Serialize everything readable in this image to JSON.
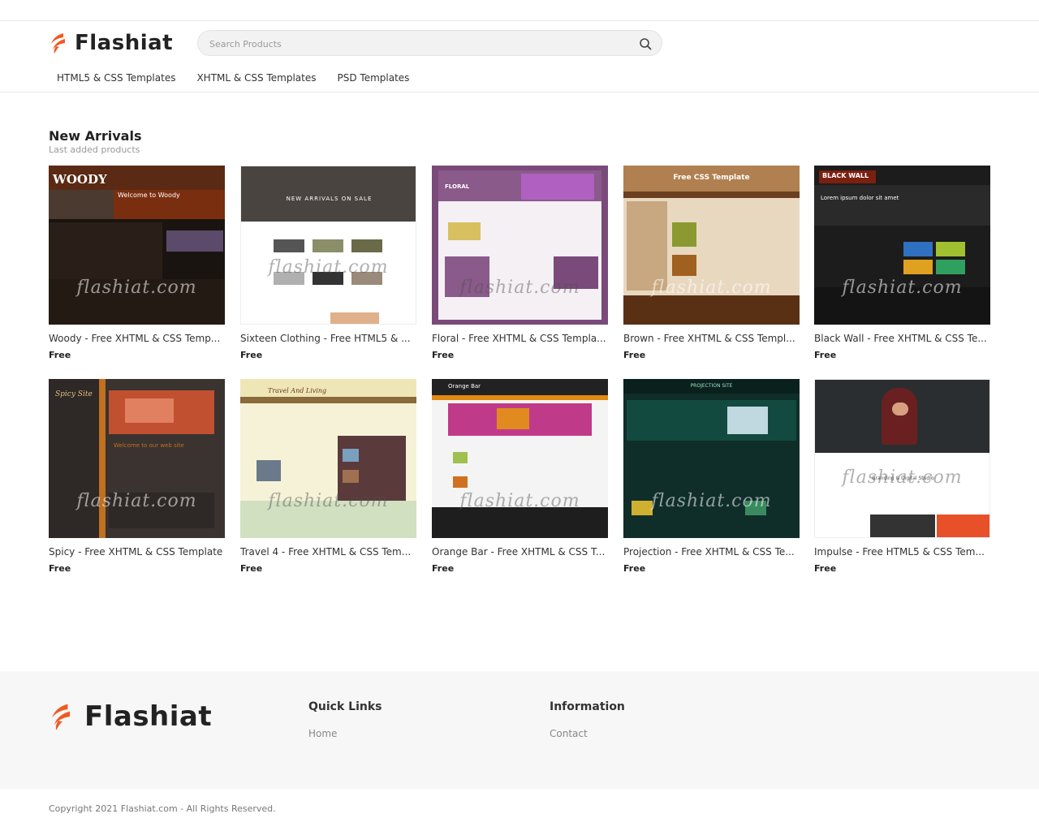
{
  "brand": {
    "name": "Flashiat",
    "accent": "#f05a22"
  },
  "search": {
    "placeholder": "Search Products",
    "icon": "search-icon"
  },
  "nav": [
    {
      "label": "HTML5 & CSS Templates"
    },
    {
      "label": "XHTML & CSS Templates"
    },
    {
      "label": "PSD Templates"
    }
  ],
  "section": {
    "title": "New Arrivals",
    "subtitle": "Last added products"
  },
  "products": [
    {
      "title": "Woody - Free XHTML & CSS Temp...",
      "price": "Free"
    },
    {
      "title": "Sixteen Clothing - Free HTML5 & ...",
      "price": "Free"
    },
    {
      "title": "Floral - Free XHTML & CSS Templa...",
      "price": "Free"
    },
    {
      "title": "Brown - Free XHTML & CSS Templ...",
      "price": "Free"
    },
    {
      "title": "Black Wall - Free XHTML & CSS Te...",
      "price": "Free"
    },
    {
      "title": "Spicy - Free XHTML & CSS Template",
      "price": "Free"
    },
    {
      "title": "Travel 4 - Free XHTML & CSS Tem...",
      "price": "Free"
    },
    {
      "title": "Orange Bar - Free XHTML & CSS T...",
      "price": "Free"
    },
    {
      "title": "Projection - Free XHTML & CSS Te...",
      "price": "Free"
    },
    {
      "title": "Impulse - Free HTML5 & CSS Tem...",
      "price": "Free"
    }
  ],
  "footer": {
    "quick_links": {
      "title": "Quick Links",
      "links": [
        "Home"
      ]
    },
    "information": {
      "title": "Information",
      "links": [
        "Contact"
      ]
    },
    "copyright": "Copyright 2021 Flashiat.com - All Rights Reserved."
  }
}
